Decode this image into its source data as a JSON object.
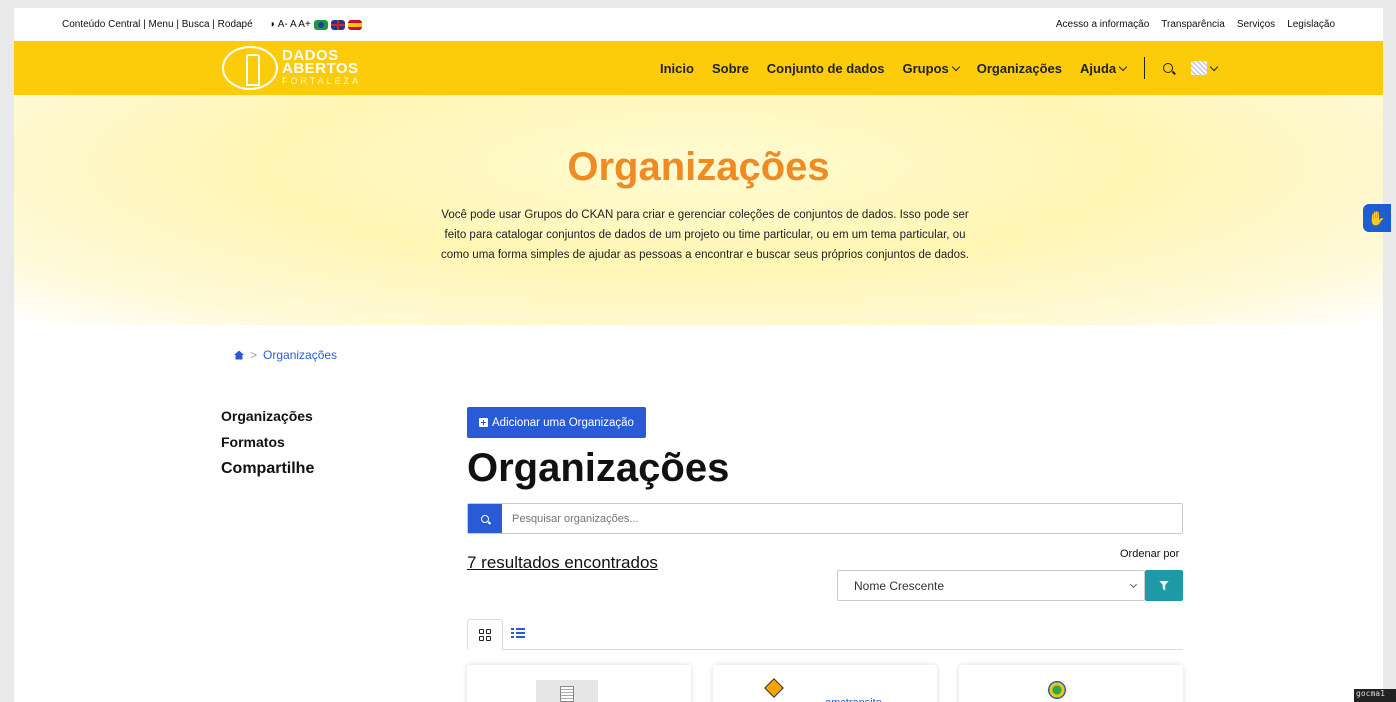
{
  "topbar": {
    "skip_links": "Conteúdo Central | Menu | Busca | Rodapé",
    "font_controls": "A- A A+",
    "right_links": [
      "Acesso a informação",
      "Transparência",
      "Serviços",
      "Legislação"
    ]
  },
  "brand": {
    "line1": "DADOS",
    "line2": "ABERTOS",
    "line3": "FORTALEZA",
    "color": "#fccc0a"
  },
  "nav": {
    "items": [
      {
        "label": "Inicio",
        "dropdown": false
      },
      {
        "label": "Sobre",
        "dropdown": false
      },
      {
        "label": "Conjunto de dados",
        "dropdown": false
      },
      {
        "label": "Grupos",
        "dropdown": true
      },
      {
        "label": "Organizações",
        "dropdown": false
      },
      {
        "label": "Ajuda",
        "dropdown": true
      }
    ]
  },
  "hero": {
    "title": "Organizações",
    "description": "Você pode usar Grupos do CKAN para criar e gerenciar coleções de conjuntos de dados. Isso pode ser feito para catalogar conjuntos de dados de um projeto ou time particular, ou em um tema particular, ou como uma forma simples de ajudar as pessoas a encontrar e buscar seus próprios conjuntos de dados."
  },
  "breadcrumb": {
    "separator": ">",
    "current": "Organizações"
  },
  "sidebar": {
    "items": [
      "Organizações",
      "Formatos"
    ],
    "share": "Compartilhe"
  },
  "main": {
    "add_button": "Adicionar uma Organização",
    "title": "Organizações",
    "search_placeholder": "Pesquisar organizações...",
    "results": "7 resultados encontrados",
    "sort_label": "Ordenar por",
    "sort_selected": "Nome Crescente",
    "cards": [
      {
        "label": ""
      },
      {
        "label": "amctransito"
      },
      {
        "label": ""
      }
    ]
  },
  "accent": {
    "primary": "#2a5bd7",
    "hero_title": "#f08a24",
    "filter": "#1e9aa6"
  },
  "corner_tag": "gocma1"
}
